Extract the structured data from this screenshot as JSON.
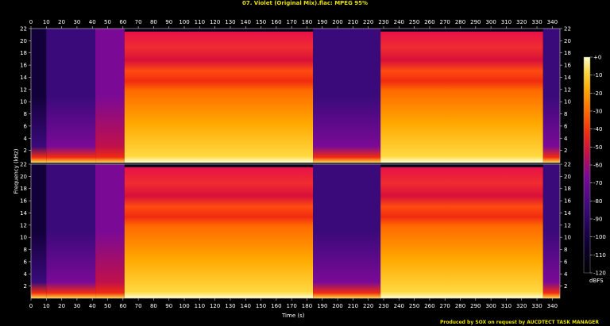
{
  "title": "07. Violet (Original Mix).flac: MPEG 95%",
  "credit": "Produced by SOX on request by AUCDTECT TASK MANAGER",
  "chart_data": {
    "type": "heatmap",
    "title": "07. Violet (Original Mix).flac: MPEG 95%",
    "xlabel": "Time (s)",
    "ylabel": "Frequency (kHz)",
    "xlim": [
      0,
      345
    ],
    "ylim": [
      0,
      22
    ],
    "x_ticks": [
      "0",
      "10",
      "20",
      "30",
      "40",
      "50",
      "60",
      "70",
      "80",
      "90",
      "100",
      "110",
      "120",
      "130",
      "140",
      "150",
      "160",
      "170",
      "180",
      "190",
      "200",
      "210",
      "220",
      "230",
      "240",
      "250",
      "260",
      "270",
      "280",
      "290",
      "300",
      "310",
      "320",
      "330",
      "340"
    ],
    "y_ticks": [
      "2",
      "4",
      "6",
      "8",
      "10",
      "12",
      "14",
      "16",
      "18",
      "20",
      "22"
    ],
    "colorbar": {
      "label": "dBFS",
      "ticks": [
        "+0",
        "-10",
        "-20",
        "-30",
        "-40",
        "-50",
        "-60",
        "-70",
        "-80",
        "-90",
        "-100",
        "-110",
        "-120"
      ],
      "range": [
        -120,
        0
      ]
    },
    "channels": 2,
    "segments": [
      {
        "start": 0,
        "end": 10,
        "level": -110,
        "cutoff": 22
      },
      {
        "start": 10,
        "end": 42,
        "level": -95,
        "cutoff": 22
      },
      {
        "start": 42,
        "end": 61,
        "level": -85,
        "cutoff": 22
      },
      {
        "start": 61,
        "end": 184,
        "level": -40,
        "cutoff": 21.5
      },
      {
        "start": 184,
        "end": 228,
        "level": -95,
        "cutoff": 22
      },
      {
        "start": 228,
        "end": 273,
        "level": -45,
        "cutoff": 21.5
      },
      {
        "start": 273,
        "end": 334,
        "level": -40,
        "cutoff": 21.5
      },
      {
        "start": 334,
        "end": 345,
        "level": -100,
        "cutoff": 22
      }
    ],
    "colors": {
      "palette": [
        "#000000",
        "#12003a",
        "#3a0a7a",
        "#7a0a96",
        "#c0104a",
        "#f02c10",
        "#ff6a00",
        "#ffa800",
        "#ffd840",
        "#ffffd0"
      ]
    }
  }
}
